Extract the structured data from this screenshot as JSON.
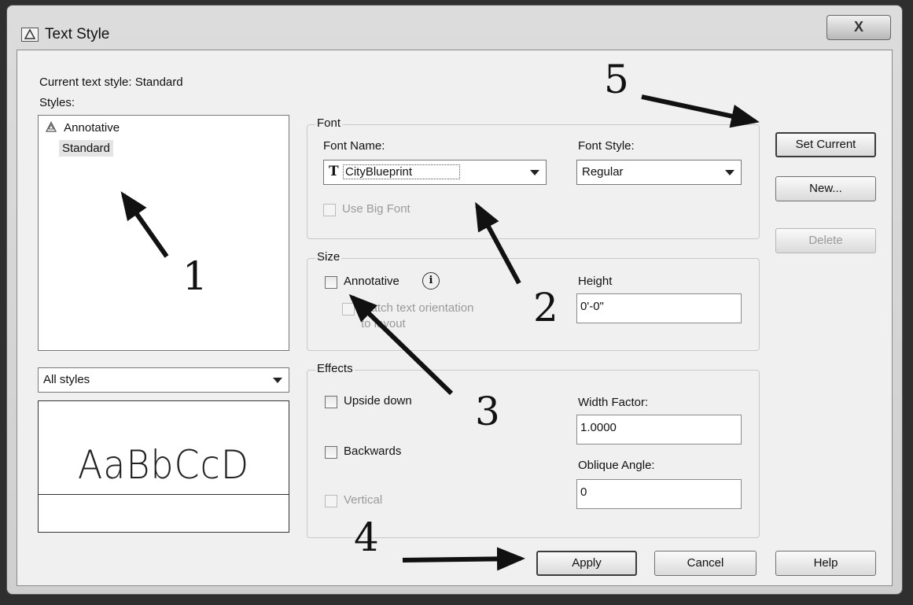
{
  "window": {
    "title": "Text Style",
    "close_label": "X"
  },
  "current_style": {
    "label": "Current text style:",
    "value": "Standard"
  },
  "styles": {
    "label": "Styles:",
    "items": [
      {
        "label": "Annotative",
        "icon": "annotative-icon"
      },
      {
        "label": "Standard"
      }
    ]
  },
  "filter": {
    "selected": "All styles"
  },
  "preview": {
    "text": "AaBbCcD"
  },
  "font": {
    "legend": "Font",
    "name_label": "Font Name:",
    "name_value": "CityBlueprint",
    "style_label": "Font Style:",
    "style_value": "Regular",
    "big_font_label": "Use Big Font"
  },
  "size": {
    "legend": "Size",
    "annotative_label": "Annotative",
    "match_label_line1": "Match text orientation",
    "match_label_line2": "to layout",
    "height_label": "Height",
    "height_value": "0'-0\""
  },
  "effects": {
    "legend": "Effects",
    "upside_down": "Upside down",
    "backwards": "Backwards",
    "vertical": "Vertical",
    "width_label": "Width Factor:",
    "width_value": "1.0000",
    "oblique_label": "Oblique Angle:",
    "oblique_value": "0"
  },
  "buttons": {
    "set_current": "Set Current",
    "new": "New...",
    "delete": "Delete",
    "apply": "Apply",
    "cancel": "Cancel",
    "help": "Help"
  },
  "annotations": [
    "1",
    "2",
    "3",
    "4",
    "5"
  ]
}
